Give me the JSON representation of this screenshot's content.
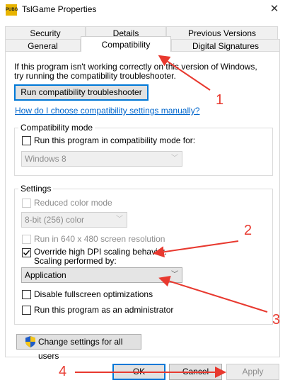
{
  "window": {
    "title": "TslGame Properties",
    "icon_text": "PUBG",
    "close_glyph": "✕"
  },
  "tabs": {
    "row1": [
      "Security",
      "Details",
      "Previous Versions"
    ],
    "row2": [
      "General",
      "Compatibility",
      "Digital Signatures"
    ]
  },
  "intro": {
    "line1": "If this program isn't working correctly on this version of Windows,",
    "line2": "try running the compatibility troubleshooter."
  },
  "troubleshooter_button": "Run compatibility troubleshooter",
  "manual_link": "How do I choose compatibility settings manually?",
  "compat_mode": {
    "legend": "Compatibility mode",
    "checkbox_label": "Run this program in compatibility mode for:",
    "checked": false,
    "os_value": "Windows 8"
  },
  "settings": {
    "legend": "Settings",
    "reduced_color": {
      "label": "Reduced color mode",
      "checked": false
    },
    "color_select": "8-bit (256) color",
    "res_640": {
      "label": "Run in 640 x 480 screen resolution",
      "checked": false
    },
    "override_dpi": {
      "label_line1": "Override high DPI scaling behavior.",
      "label_line2": "Scaling performed by:",
      "checked": true
    },
    "scaling_select": "Application",
    "disable_fullscreen": {
      "label": "Disable fullscreen optimizations",
      "checked": false
    },
    "run_admin": {
      "label": "Run this program as an administrator",
      "checked": false
    }
  },
  "change_settings_button": "Change settings for all users",
  "shield_icon": "uac-shield-icon",
  "footer": {
    "ok": "OK",
    "cancel": "Cancel",
    "apply": "Apply"
  },
  "annotations": [
    "1",
    "2",
    "3",
    "4"
  ],
  "colors": {
    "accent": "#0078d7",
    "link": "#0066cc",
    "annotation": "#e8392f"
  }
}
